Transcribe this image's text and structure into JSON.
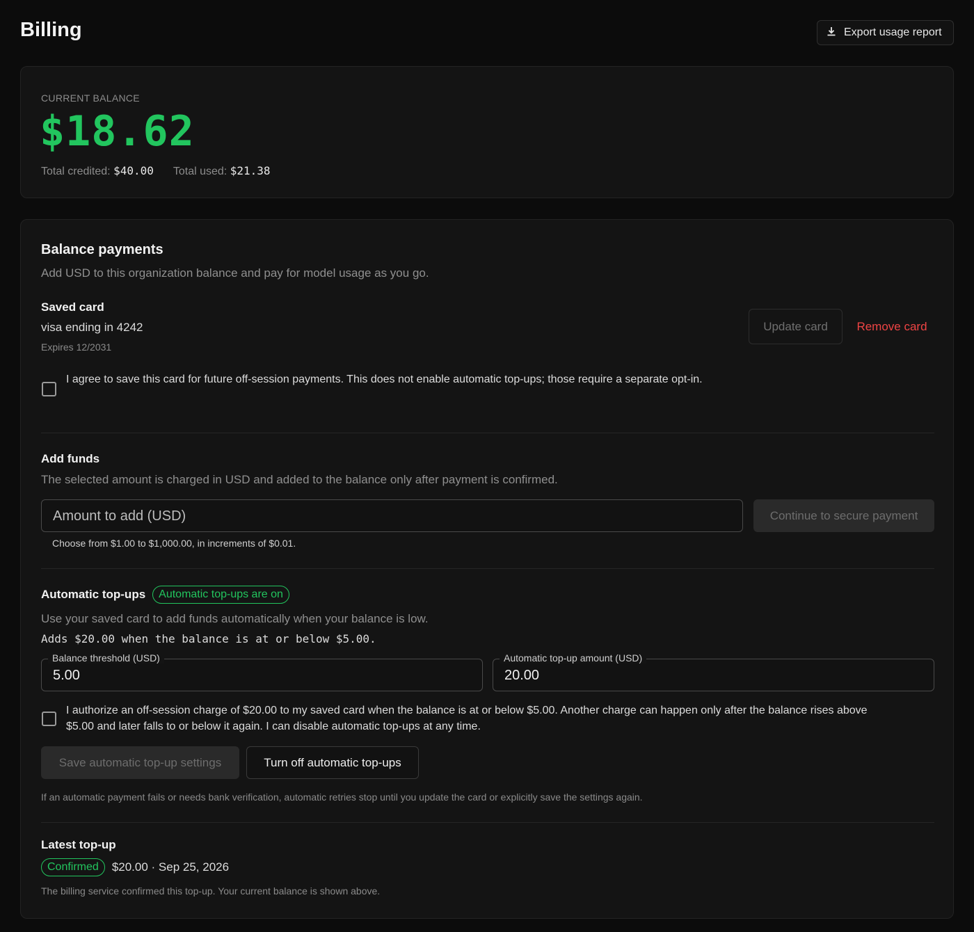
{
  "header": {
    "title": "Billing",
    "export_label": "Export usage report"
  },
  "balance": {
    "label": "CURRENT BALANCE",
    "amount": "$18.62",
    "credited_label": "Total credited:",
    "credited_value": "$40.00",
    "used_label": "Total used:",
    "used_value": "$21.38"
  },
  "payments": {
    "title": "Balance payments",
    "description": "Add USD to this organization balance and pay for model usage as you go.",
    "saved_card": {
      "heading": "Saved card",
      "card_text": "visa ending in 4242",
      "expiry": "Expires 12/2031",
      "update_label": "Update card",
      "remove_label": "Remove card",
      "consent_text": "I agree to save this card for future off-session payments. This does not enable automatic top-ups; those require a separate opt-in."
    },
    "add_funds": {
      "heading": "Add funds",
      "description": "The selected amount is charged in USD and added to the balance only after payment is confirmed.",
      "amount_placeholder": "Amount to add (USD)",
      "continue_label": "Continue to secure payment",
      "helper": "Choose from $1.00 to $1,000.00, in increments of $0.01."
    },
    "auto_topup": {
      "heading": "Automatic top-ups",
      "status_badge": "Automatic top-ups are on",
      "description": "Use your saved card to add funds automatically when your balance is low.",
      "rule_text": "Adds $20.00 when the balance is at or below $5.00.",
      "threshold_label": "Balance threshold (USD)",
      "threshold_value": "5.00",
      "amount_label": "Automatic top-up amount (USD)",
      "amount_value": "20.00",
      "authorize_text_line1": "I authorize an off-session charge of $20.00 to my saved card when the balance is at or below $5.00. Another charge can happen only after the balance rises above",
      "authorize_text_line2": "$5.00 and later falls to or below it again. I can disable automatic top-ups at any time.",
      "save_label": "Save automatic top-up settings",
      "turn_off_label": "Turn off automatic top-ups",
      "footnote": "If an automatic payment fails or needs bank verification, automatic retries stop until you update the card or explicitly save the settings again."
    },
    "latest": {
      "heading": "Latest top-up",
      "status": "Confirmed",
      "summary": "$20.00 · Sep 25, 2026",
      "note": "The billing service confirmed this top-up. Your current balance is shown above."
    }
  },
  "colors": {
    "background": "#0c0c0c",
    "card": "#141414",
    "accent_green": "#22c55e",
    "danger_red": "#ef4444"
  },
  "icons": {
    "export": "download-icon"
  }
}
